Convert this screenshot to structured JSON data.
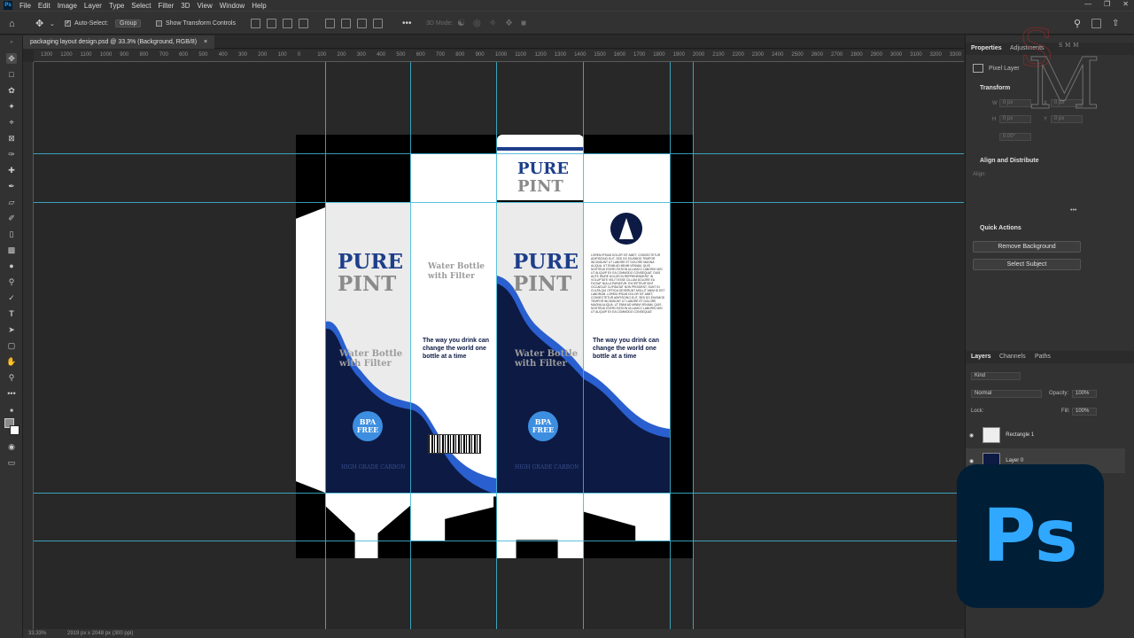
{
  "app": {
    "menu": [
      "File",
      "Edit",
      "Image",
      "Layer",
      "Type",
      "Select",
      "Filter",
      "3D",
      "View",
      "Window",
      "Help"
    ],
    "logo_text": "Ps"
  },
  "options_bar": {
    "auto_select_label": "Auto-Select:",
    "auto_select_value": "Group",
    "show_transform_label": "Show Transform Controls",
    "mode_3d_label": "3D Mode:"
  },
  "document": {
    "tab_title": "packaging layout design.psd @ 33.3% (Background, RGB/8)",
    "close_glyph": "×",
    "zoom": "33.33%",
    "doc_info": "2919 px x 2048 px (300 ppi)"
  },
  "ruler_top_labels": [
    "1300",
    "1200",
    "1100",
    "1000",
    "900",
    "800",
    "700",
    "600",
    "500",
    "400",
    "300",
    "200",
    "100",
    "0",
    "100",
    "200",
    "300",
    "400",
    "500",
    "600",
    "700",
    "800",
    "900",
    "1000",
    "1100",
    "1200",
    "1300",
    "1400",
    "1500",
    "1600",
    "1700",
    "1800",
    "1900",
    "2000",
    "2100",
    "2200",
    "2300",
    "2400",
    "2500",
    "2600",
    "2700",
    "2800",
    "2900",
    "3000",
    "3100",
    "3200",
    "3300",
    "3400"
  ],
  "packaging": {
    "brand_line1": "PURE",
    "brand_line2": "PINT",
    "product": "Water Bottle with Filter",
    "slogan": "The way you drink can change the world one bottle at a time",
    "badge": "BPA FREE",
    "grade": "HIGH GRADE CARBON",
    "lorem": "LOREM IPSUM DOLOR SIT AMET, CONSECTETUR ADIPISCING ELIT, SED DO EIUSMOD TEMPOR INCIDIDUNT UT LABORE ET DOLORE MAGNA ALIQUA. UT ENIM AD MINIM VENIAM, QUIS NOSTRUD EXERCITATION ULLAMCO LABORIS NISI UT ALIQUIP EX EA COMMODO CONSEQUAT. DUIS AUTE IRURE DOLOR IN REPREHENDERIT IN VOLUPTATE VELIT ESSE CILLUM DOLORE EU FUGIAT NULLA PARIATUR. EXCEPTEUR SINT OCCAECAT CUPIDATAT NON PROIDENT, SUNT IN CULPA QUI OFFICIA DESERUNT MOLLIT ANIM ID EST LABORUM. LOREM IPSUM DOLOR SIT AMET, CONSECTETUR ADIPISCING ELIT, SED DO EIUSMOD TEMPOR INCIDIDUNT UT LABORE ET DOLORE MAGNA ALIQUA. UT ENIM AD MINIM VENIAM, QUIS NOSTRUD EXERCITATION ULLAMCO LABORIS NISI UT ALIQUIP EX EA COMMODO CONSEQUAT."
  },
  "properties_panel": {
    "tabs": [
      "Properties",
      "Adjustments"
    ],
    "layer_type": "Pixel Layer",
    "transform_title": "Transform",
    "w_label": "W",
    "w_value": "0 px",
    "x_label": "X",
    "x_value": "0 px",
    "h_label": "H",
    "h_value": "0 px",
    "y_label": "Y",
    "y_value": "0 px",
    "angle_value": "0.00°",
    "align_title": "Align and Distribute",
    "align_label": "Align:",
    "more_glyph": "•••",
    "quick_actions_title": "Quick Actions",
    "remove_bg": "Remove Background",
    "select_subject": "Select Subject"
  },
  "layers_panel": {
    "tabs": [
      "Layers",
      "Channels",
      "Paths"
    ],
    "kind_label": "Kind",
    "blend_mode": "Normal",
    "opacity_label": "Opacity:",
    "opacity_value": "100%",
    "lock_label": "Lock:",
    "fill_label": "Fill:",
    "fill_value": "100%",
    "layers": [
      "Rectangle 1",
      "Layer 0"
    ]
  },
  "watermark_text": "SMM"
}
